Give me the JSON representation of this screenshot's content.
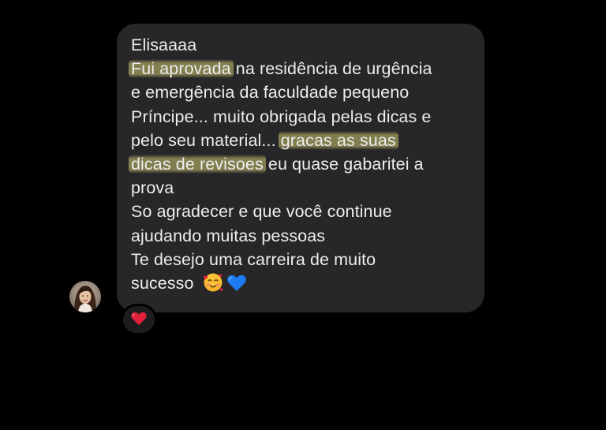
{
  "message": {
    "lines": [
      "Elisaaaa",
      {
        "highlight": "Fui aprovada",
        "rest": " na residência de urgência"
      },
      "e emergência da faculdade pequeno",
      "Príncipe... muito obrigada pelas dicas e",
      {
        "pre": "pelo seu material... ",
        "highlight": "gracas as suas"
      },
      {
        "highlight": "dicas de revisoes",
        "rest": " eu quase gabaritei a"
      },
      "prova",
      "So agradecer e que você continue",
      "ajudando muitas pessoas",
      "Te desejo uma carreira de muito",
      {
        "text": "sucesso",
        "emojis": [
          "smiling-face-with-hearts",
          "blue-heart"
        ]
      }
    ],
    "line_0": "Elisaaaa",
    "line_1_highlight": "Fui aprovada",
    "line_1_rest": " na residência de urgência",
    "line_2": "e emergência da faculdade pequeno",
    "line_3": "Príncipe... muito obrigada pelas dicas e",
    "line_4_pre": "pelo seu material... ",
    "line_4_highlight": "gracas as suas",
    "line_5_highlight": "dicas de revisoes",
    "line_5_rest": " eu quase gabaritei a",
    "line_6": "prova",
    "line_7": "So agradecer e que você continue",
    "line_8": "ajudando muitas pessoas",
    "line_9": "Te desejo uma carreira de muito",
    "line_10": "sucesso",
    "emojis": [
      "smiling-face-with-hearts-icon",
      "blue-heart-icon"
    ]
  },
  "reaction": {
    "icon": "red-heart-icon"
  },
  "colors": {
    "background": "#000000",
    "bubble": "#272729",
    "text": "#ededed",
    "highlight": "#cbc56e",
    "reaction_heart": "#e0203a",
    "blue_heart": "#1d7cf2"
  }
}
